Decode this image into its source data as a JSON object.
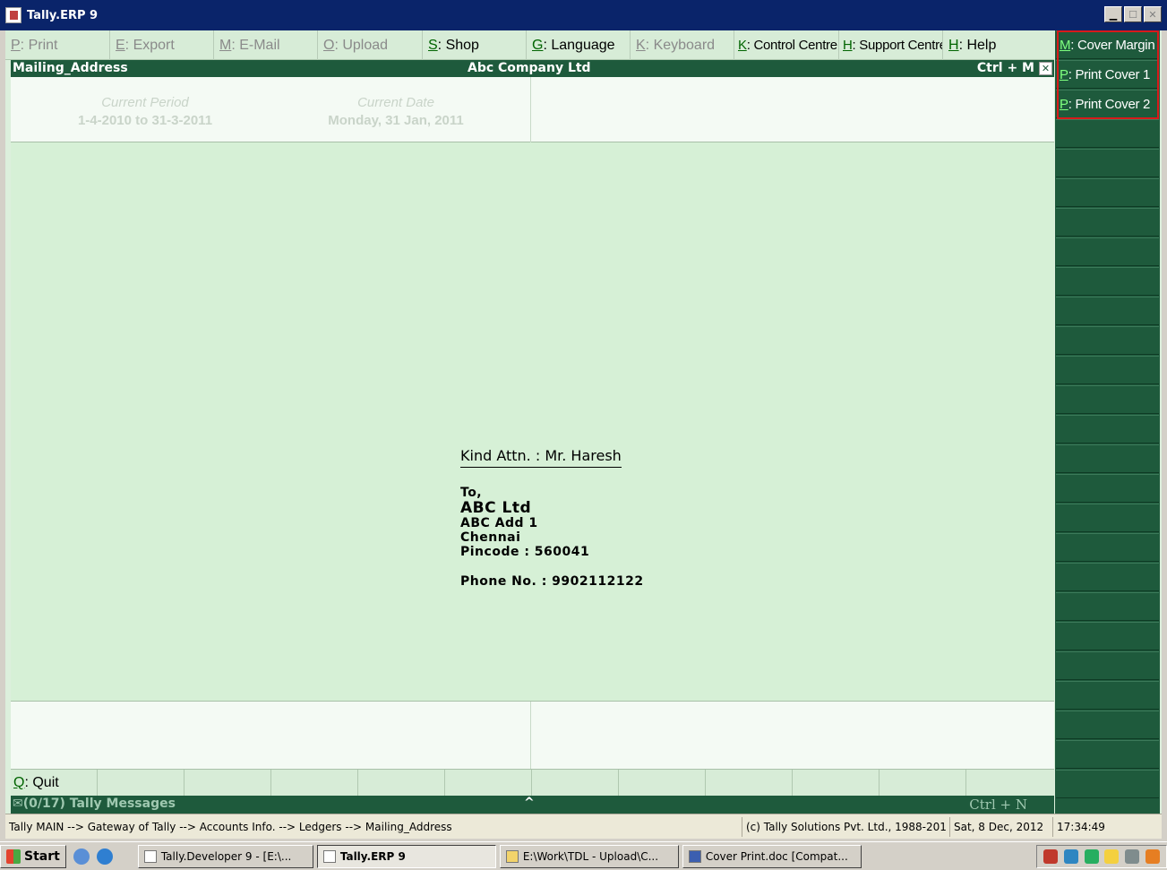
{
  "window": {
    "title": "Tally.ERP 9"
  },
  "top_buttons": [
    {
      "key": "P",
      "label": ": Print",
      "enabled": false
    },
    {
      "key": "E",
      "label": ": Export",
      "enabled": false
    },
    {
      "key": "M",
      "label": ": E-Mail",
      "enabled": false
    },
    {
      "key": "O",
      "label": ": Upload",
      "enabled": false
    },
    {
      "key": "S",
      "label": ": Shop",
      "enabled": true
    },
    {
      "key": "G",
      "label": ": Language",
      "enabled": true
    },
    {
      "key": "K",
      "label": ": Keyboard",
      "enabled": false
    },
    {
      "key": "K",
      "label": ": Control Centre",
      "enabled": true
    },
    {
      "key": "H",
      "label": ": Support Centre",
      "enabled": true
    },
    {
      "key": "H",
      "label": ": Help",
      "enabled": true
    }
  ],
  "header": {
    "report": "Mailing_Address",
    "company": "Abc Company Ltd",
    "shortcut": "Ctrl + M",
    "close_symbol": "✕"
  },
  "period": {
    "current_period_label": "Current Period",
    "current_period_value": "1-4-2010 to 31-3-2011",
    "current_date_label": "Current Date",
    "current_date_value": "Monday, 31 Jan, 2011"
  },
  "address": {
    "attn": "Kind Attn. : Mr. Haresh",
    "to": "To,",
    "name": "ABC Ltd",
    "line1": "ABC Add 1",
    "city": "Chennai",
    "pincode": "Pincode : 560041",
    "phone": "Phone No. : 9902112122"
  },
  "bottom_buttons": [
    {
      "key": "Q",
      "label": ": Quit"
    }
  ],
  "messages": {
    "label": "(0/17) Tally Messages",
    "toggle": "^",
    "shortcut": "Ctrl + N"
  },
  "right_buttons": [
    {
      "key": "M",
      "label": ": Cover Margin"
    },
    {
      "key": "P",
      "label": ": Print Cover 1"
    },
    {
      "key": "P",
      "label": ": Print Cover 2"
    }
  ],
  "status": {
    "breadcrumb": "Tally MAIN --> Gateway of Tally --> Accounts Info. --> Ledgers --> Mailing_Address",
    "copyright": "(c) Tally Solutions Pvt. Ltd., 1988-201",
    "date": "Sat, 8 Dec, 2012",
    "time": "17:34:49"
  },
  "taskbar": {
    "start": "Start",
    "tasks": [
      {
        "label": "Tally.Developer 9 - [E:\\...",
        "active": false
      },
      {
        "label": "Tally.ERP 9",
        "active": true
      },
      {
        "label": "E:\\Work\\TDL - Upload\\C...",
        "active": false
      },
      {
        "label": "Cover Print.doc [Compat...",
        "active": false
      }
    ]
  },
  "colors": {
    "tally_green": "#1e5a3c",
    "body_green": "#d6f0d6",
    "highlight_red": "#d81a1a",
    "title_blue": "#0a246a"
  }
}
